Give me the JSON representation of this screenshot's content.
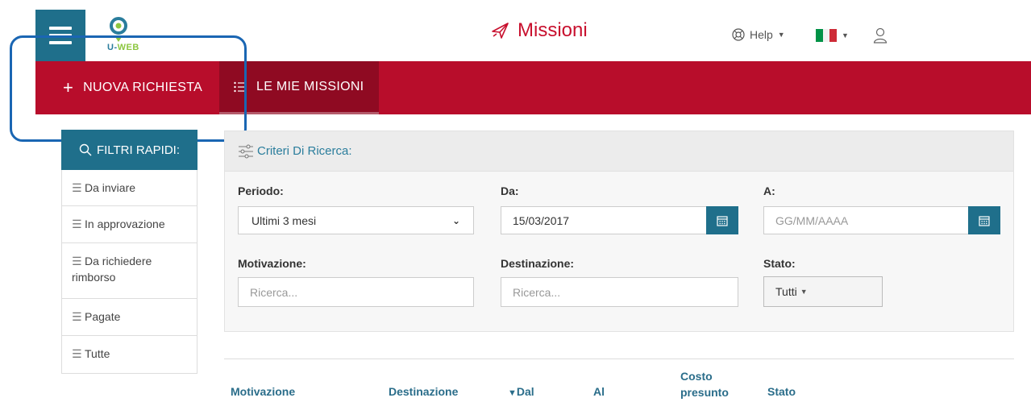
{
  "header": {
    "logo_text_main": "U-",
    "logo_text_accent": "WEB",
    "title": "Missioni",
    "help_label": "Help",
    "brand_color": "#c8102e",
    "primary_color": "#1f6f8b"
  },
  "nav": {
    "new_request": "NUOVA RICHIESTA",
    "my_missions": "LE MIE MISSIONI"
  },
  "sidebar": {
    "title": "FILTRI RAPIDI:",
    "items": [
      {
        "label": "Da inviare"
      },
      {
        "label": "In approvazione"
      },
      {
        "label": "Da richiedere rimborso"
      },
      {
        "label": "Pagate"
      },
      {
        "label": "Tutte"
      }
    ]
  },
  "search": {
    "title": "Criteri Di Ricerca:",
    "periodo_label": "Periodo:",
    "periodo_value": "Ultimi 3 mesi",
    "da_label": "Da:",
    "da_value": "15/03/2017",
    "a_label": "A:",
    "a_placeholder": "GG/MM/AAAA",
    "motivazione_label": "Motivazione:",
    "motivazione_placeholder": "Ricerca...",
    "destinazione_label": "Destinazione:",
    "destinazione_placeholder": "Ricerca...",
    "stato_label": "Stato:",
    "stato_value": "Tutti"
  },
  "table": {
    "columns": [
      "Motivazione",
      "Destinazione",
      "Dal",
      "Al",
      "Costo presunto",
      "Stato"
    ],
    "sort_indicator": "▼"
  }
}
